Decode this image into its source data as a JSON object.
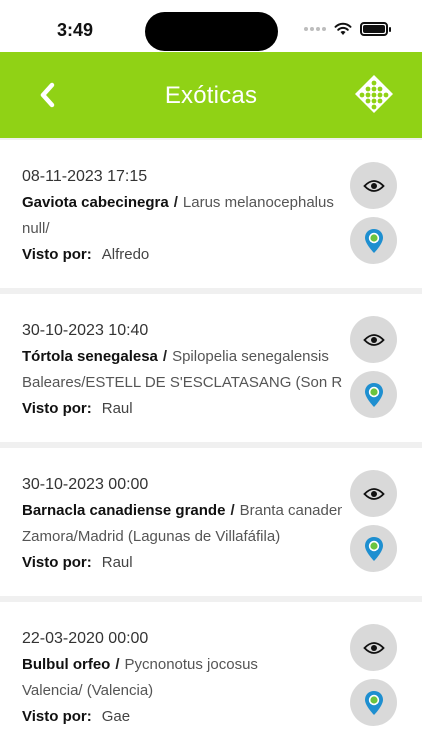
{
  "status_bar": {
    "time": "3:49"
  },
  "header": {
    "title": "Exóticas",
    "back_icon": "chevron-left-icon",
    "logo_icon": "dots-diamond-logo"
  },
  "colors": {
    "accent": "#90d215",
    "pin": "#1e8fd0",
    "pin_inner": "#6bc43f"
  },
  "seen_label": "Visto por:",
  "sightings": [
    {
      "date": "08-11-2023 17:15",
      "common_name": "Gaviota cabecinegra",
      "separator": "/",
      "scientific_name": "Larus melanocephalus",
      "location": "null/",
      "seen_by": "Alfredo"
    },
    {
      "date": "30-10-2023 10:40",
      "common_name": "Tórtola senegalesa",
      "separator": "/",
      "scientific_name": "Spilopelia senegalensis",
      "location": "Baleares/ESTELL DE S'ESCLATASANG (Son Roqueta)",
      "seen_by": "Raul"
    },
    {
      "date": "30-10-2023 00:00",
      "common_name": "Barnacla canadiense grande",
      "separator": "/",
      "scientific_name": "Branta canadensis",
      "location": "Zamora/Madrid (Lagunas de Villafáfila)",
      "seen_by": "Raul"
    },
    {
      "date": "22-03-2020 00:00",
      "common_name": "Bulbul orfeo",
      "separator": "/",
      "scientific_name": "Pycnonotus jocosus",
      "location": "Valencia/ (Valencia)",
      "seen_by": "Gae"
    }
  ]
}
